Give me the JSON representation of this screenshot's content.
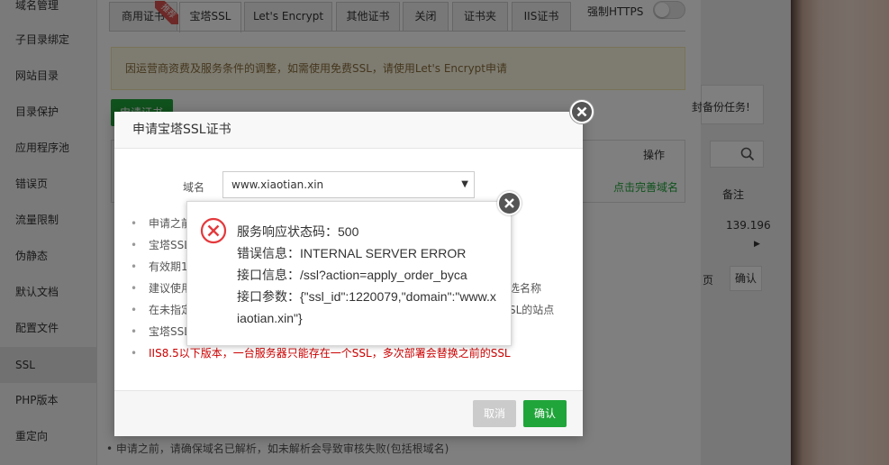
{
  "sidebar": {
    "items": [
      "域名管理",
      "子目录绑定",
      "网站目录",
      "目录保护",
      "应用程序池",
      "错误页",
      "流量限制",
      "伪静态",
      "默认文档",
      "配置文件",
      "SSL",
      "PHP版本",
      "重定向"
    ],
    "active": "SSL"
  },
  "tabs": [
    {
      "label": "商用证书",
      "badge": "推荐"
    },
    {
      "label": "宝塔SSL"
    },
    {
      "label": "Let's Encrypt"
    },
    {
      "label": "其他证书"
    },
    {
      "label": "关闭"
    },
    {
      "label": "证书夹"
    },
    {
      "label": "IIS证书"
    }
  ],
  "https_toggle": {
    "label": "强制HTTPS",
    "enabled": false
  },
  "notice": "因运营商资费及服务条件的调整，如需使用免费SSL，请使用Let's Encrypt申请",
  "apply_button": "申请证书",
  "table": {
    "op_header": "操作",
    "complete_link": "点击完善域名"
  },
  "bottom_note": "申请之前，请确保域名已解析，如未解析会导致审核失败(包括根域名)",
  "right_panel": {
    "task_text": "封备份任务!",
    "col_header": "备注",
    "ip_fragment": "139.196",
    "page_label": "页",
    "confirm_label": "确认"
  },
  "modal": {
    "title": "申请宝塔SSL证书",
    "domain_label": "域名",
    "domain_value": "www.xiaotian.xin",
    "tips": [
      "申请之前，请确保域名已解析",
      "宝塔SSL",
      "有效期1",
      "建议使用",
      "在未指定",
      "宝塔SSL",
      "IIS8.5以下版本，一台服务器只能存在一个SSL，多次部署会替换之前的SSL"
    ],
    "tip_suffixes": [
      "",
      "",
      "",
      "选名称",
      "SL的站点",
      "",
      ""
    ],
    "cancel_label": "取消",
    "ok_label": "确认"
  },
  "error": {
    "line1": "服务响应状态码：500",
    "line2": "错误信息：INTERNAL SERVER ERROR",
    "line3": "接口信息：/ssl?action=apply_order_byca",
    "line4": "接口参数：{\"ssl_id\":1220079,\"domain\":\"www.xiaotian.xin\"}"
  },
  "colors": {
    "accent": "#20a53a",
    "error": "#e4393c",
    "warning_bg": "#fcf8e3"
  }
}
